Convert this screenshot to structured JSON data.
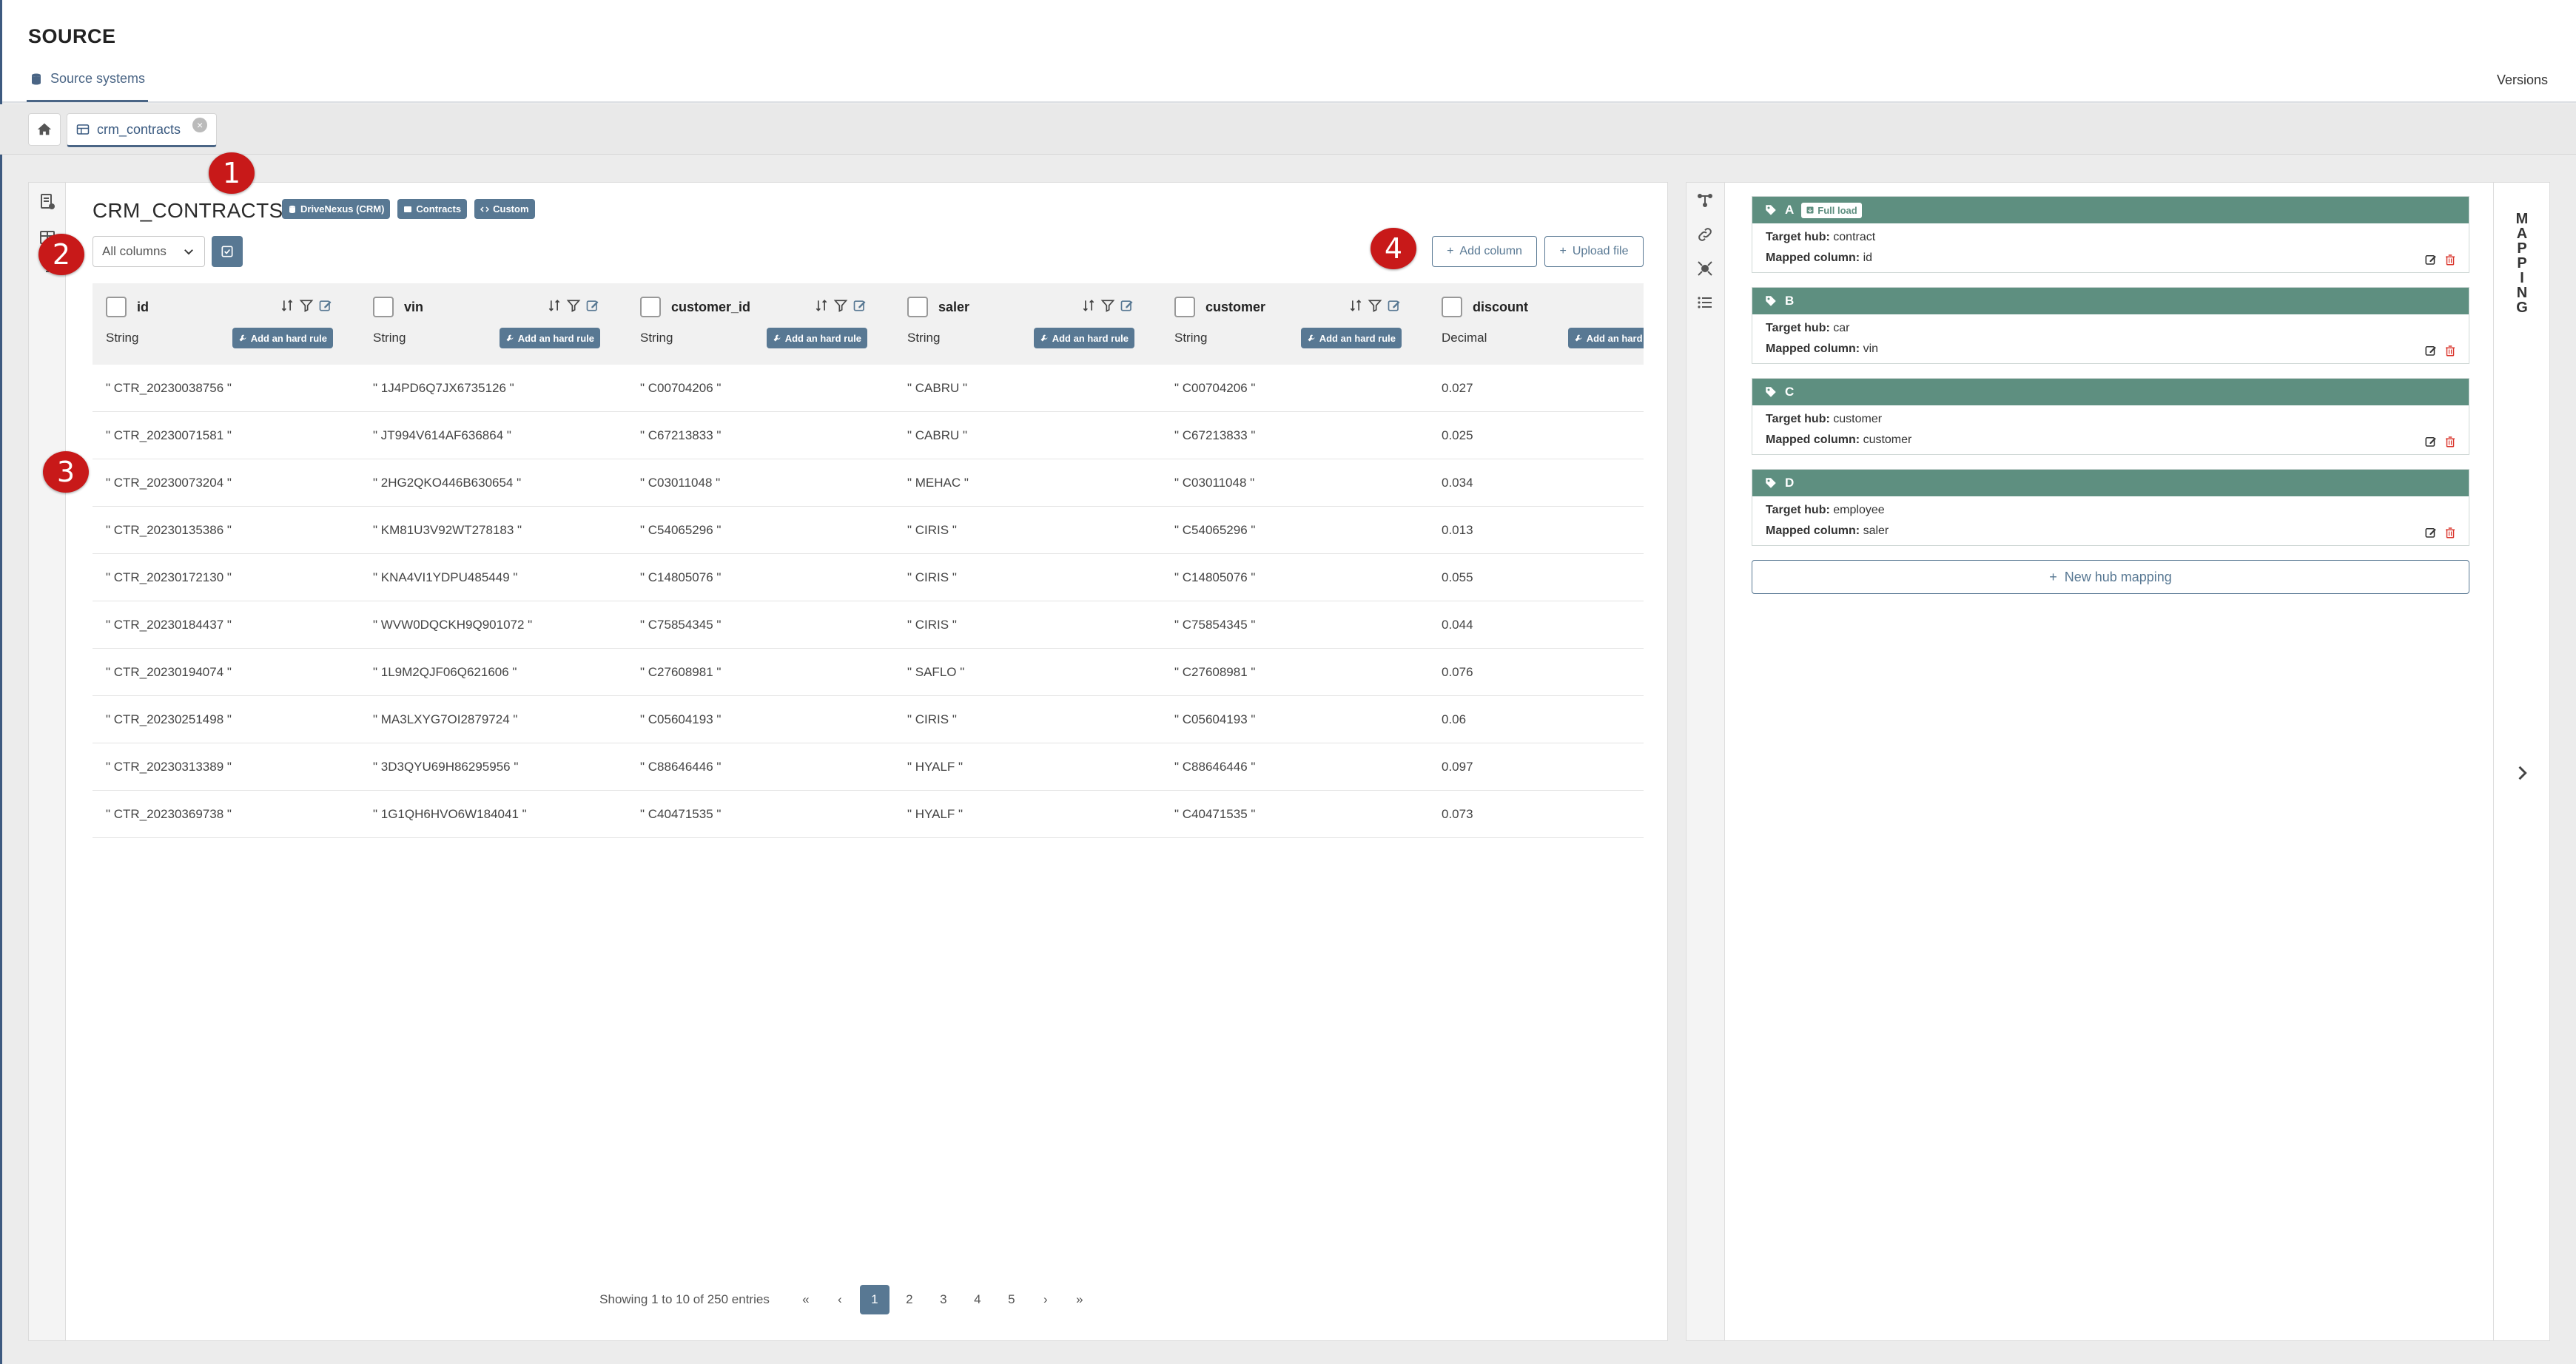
{
  "header": {
    "app_title": "SOURCE",
    "nav_tab": "Source systems",
    "versions": "Versions"
  },
  "tabs": {
    "open_tab": "crm_contracts"
  },
  "table": {
    "title": "CRM_CONTRACTS",
    "badges": [
      {
        "label": "DriveNexus (CRM)",
        "icon": "database-icon"
      },
      {
        "label": "Contracts",
        "icon": "table-icon"
      },
      {
        "label": "Custom",
        "icon": "code-icon"
      }
    ],
    "column_select": "All columns",
    "add_column": "Add column",
    "upload_file": "Upload file",
    "rule_button": "Add an hard rule",
    "columns": [
      {
        "name": "id",
        "type": "String"
      },
      {
        "name": "vin",
        "type": "String"
      },
      {
        "name": "customer_id",
        "type": "String"
      },
      {
        "name": "saler",
        "type": "String"
      },
      {
        "name": "customer",
        "type": "String"
      },
      {
        "name": "discount",
        "type": "Decimal"
      }
    ],
    "rows": [
      [
        "\" CTR_20230038756 \"",
        "\" 1J4PD6Q7JX6735126 \"",
        "\" C00704206 \"",
        "\" CABRU \"",
        "\" C00704206 \"",
        "0.027"
      ],
      [
        "\" CTR_20230071581 \"",
        "\" JT994V614AF636864 \"",
        "\" C67213833 \"",
        "\" CABRU \"",
        "\" C67213833 \"",
        "0.025"
      ],
      [
        "\" CTR_20230073204 \"",
        "\" 2HG2QKO446B630654 \"",
        "\" C03011048 \"",
        "\" MEHAC \"",
        "\" C03011048 \"",
        "0.034"
      ],
      [
        "\" CTR_20230135386 \"",
        "\" KM81U3V92WT278183 \"",
        "\" C54065296 \"",
        "\" CIRIS \"",
        "\" C54065296 \"",
        "0.013"
      ],
      [
        "\" CTR_20230172130 \"",
        "\" KNA4VI1YDPU485449 \"",
        "\" C14805076 \"",
        "\" CIRIS \"",
        "\" C14805076 \"",
        "0.055"
      ],
      [
        "\" CTR_20230184437 \"",
        "\" WVW0DQCKH9Q901072 \"",
        "\" C75854345 \"",
        "\" CIRIS \"",
        "\" C75854345 \"",
        "0.044"
      ],
      [
        "\" CTR_20230194074 \"",
        "\" 1L9M2QJF06Q621606 \"",
        "\" C27608981 \"",
        "\" SAFLO \"",
        "\" C27608981 \"",
        "0.076"
      ],
      [
        "\" CTR_20230251498 \"",
        "\" MA3LXYG7OI2879724 \"",
        "\" C05604193 \"",
        "\" CIRIS \"",
        "\" C05604193 \"",
        "0.06"
      ],
      [
        "\" CTR_20230313389 \"",
        "\" 3D3QYU69H86295956 \"",
        "\" C88646446 \"",
        "\" HYALF \"",
        "\" C88646446 \"",
        "0.097"
      ],
      [
        "\" CTR_20230369738 \"",
        "\" 1G1QH6HVO6W184041 \"",
        "\" C40471535 \"",
        "\" HYALF \"",
        "\" C40471535 \"",
        "0.073"
      ]
    ],
    "pagination": {
      "info": "Showing 1 to 10 of 250 entries",
      "first": "«",
      "prev": "‹",
      "pages": [
        "1",
        "2",
        "3",
        "4",
        "5"
      ],
      "next": "›",
      "last": "»",
      "active_page": "1"
    }
  },
  "markers": [
    "1",
    "2",
    "3",
    "4"
  ],
  "mapping": {
    "vertical_label": "MAPPING",
    "target_hub_label": "Target hub:",
    "mapped_column_label": "Mapped column:",
    "hubs": [
      {
        "letter": "A",
        "load": "Full load",
        "target_hub": "contract",
        "mapped_column": "id"
      },
      {
        "letter": "B",
        "load": "",
        "target_hub": "car",
        "mapped_column": "vin"
      },
      {
        "letter": "C",
        "load": "",
        "target_hub": "customer",
        "mapped_column": "customer"
      },
      {
        "letter": "D",
        "load": "",
        "target_hub": "employee",
        "mapped_column": "saler"
      }
    ],
    "new_hub": "New hub mapping"
  },
  "colors": {
    "accent": "#587893",
    "hub_header": "#5e8f80",
    "marker": "#c81919"
  }
}
